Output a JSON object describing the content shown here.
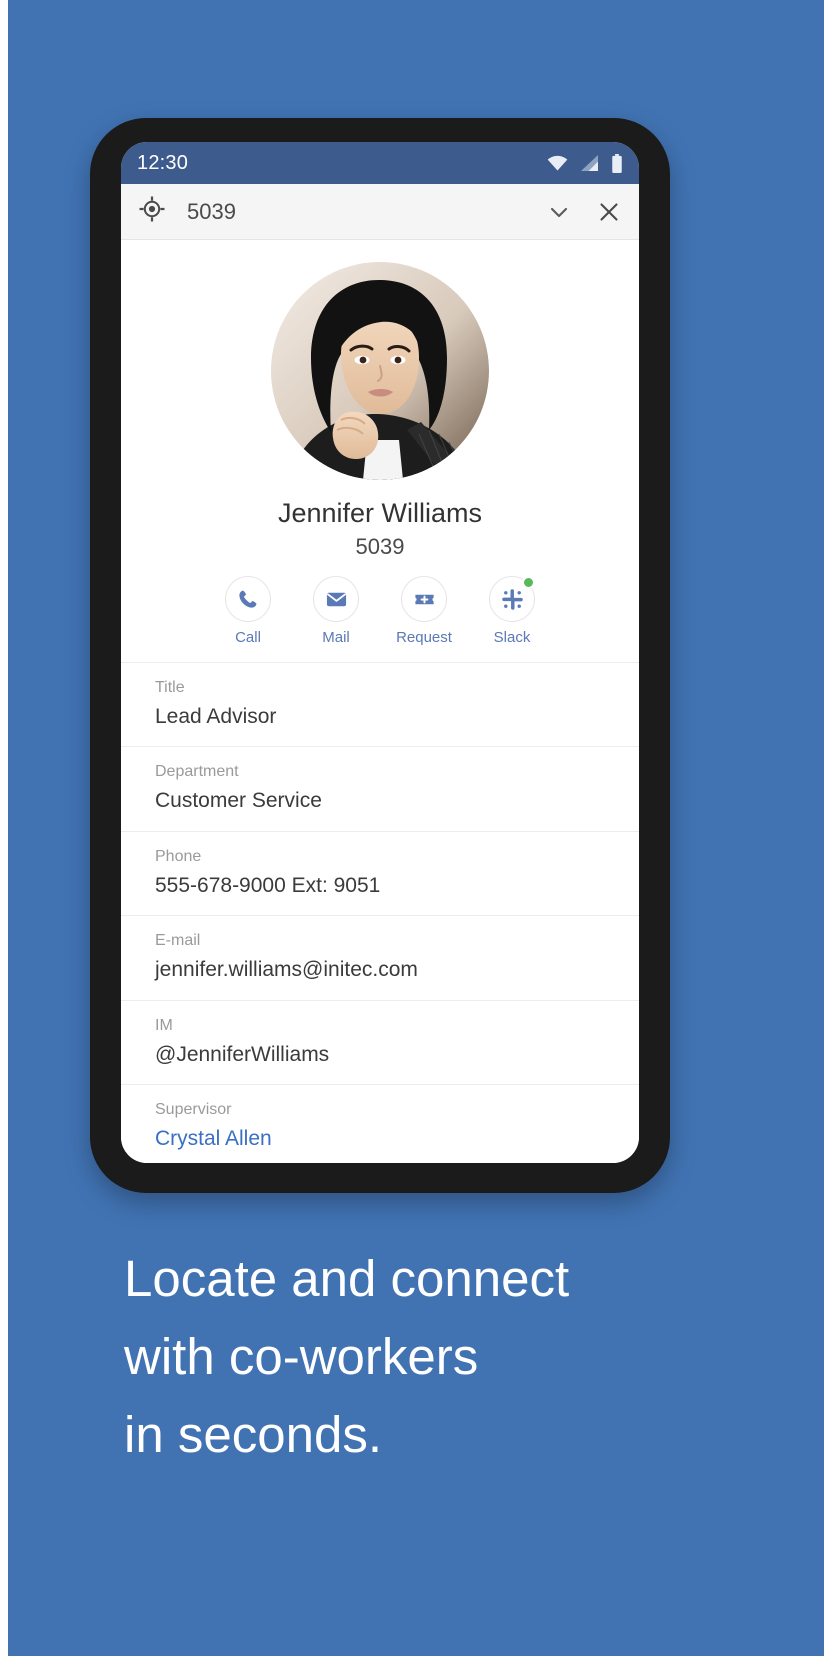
{
  "promo": {
    "background_color": "#4173b3",
    "caption_lines": [
      "Locate and connect",
      "with co-workers",
      "in seconds."
    ]
  },
  "phone": {
    "status_bar": {
      "time": "12:30",
      "background_color": "#3d5b8c",
      "icons": [
        "wifi-icon",
        "cell-signal-icon",
        "battery-icon"
      ]
    },
    "toolbar": {
      "locate_icon": "gps-target-icon",
      "title": "5039",
      "expand_icon": "chevron-down-icon",
      "close_icon": "close-icon",
      "background_color": "#f5f5f5"
    },
    "profile": {
      "avatar_alt": "avatar",
      "name": "Jennifer Williams",
      "extension": "5039",
      "actions": [
        {
          "label": "Call",
          "icon": "phone-icon",
          "presence": false
        },
        {
          "label": "Mail",
          "icon": "envelope-icon",
          "presence": false
        },
        {
          "label": "Request",
          "icon": "ticket-plus-icon",
          "presence": false
        },
        {
          "label": "Slack",
          "icon": "slack-icon",
          "presence": true
        }
      ],
      "presence_color": "#58b957",
      "accent_color": "#5b79b5",
      "link_color": "#3a6fc4",
      "details": [
        {
          "label": "Title",
          "value": "Lead Advisor",
          "is_link": false
        },
        {
          "label": "Department",
          "value": "Customer Service",
          "is_link": false
        },
        {
          "label": "Phone",
          "value": "555-678-9000 Ext: 9051",
          "is_link": false
        },
        {
          "label": "E-mail",
          "value": "jennifer.williams@initec.com",
          "is_link": false
        },
        {
          "label": "IM",
          "value": "@JenniferWilliams",
          "is_link": false
        },
        {
          "label": "Supervisor",
          "value": "Crystal Allen",
          "is_link": true
        }
      ]
    }
  }
}
